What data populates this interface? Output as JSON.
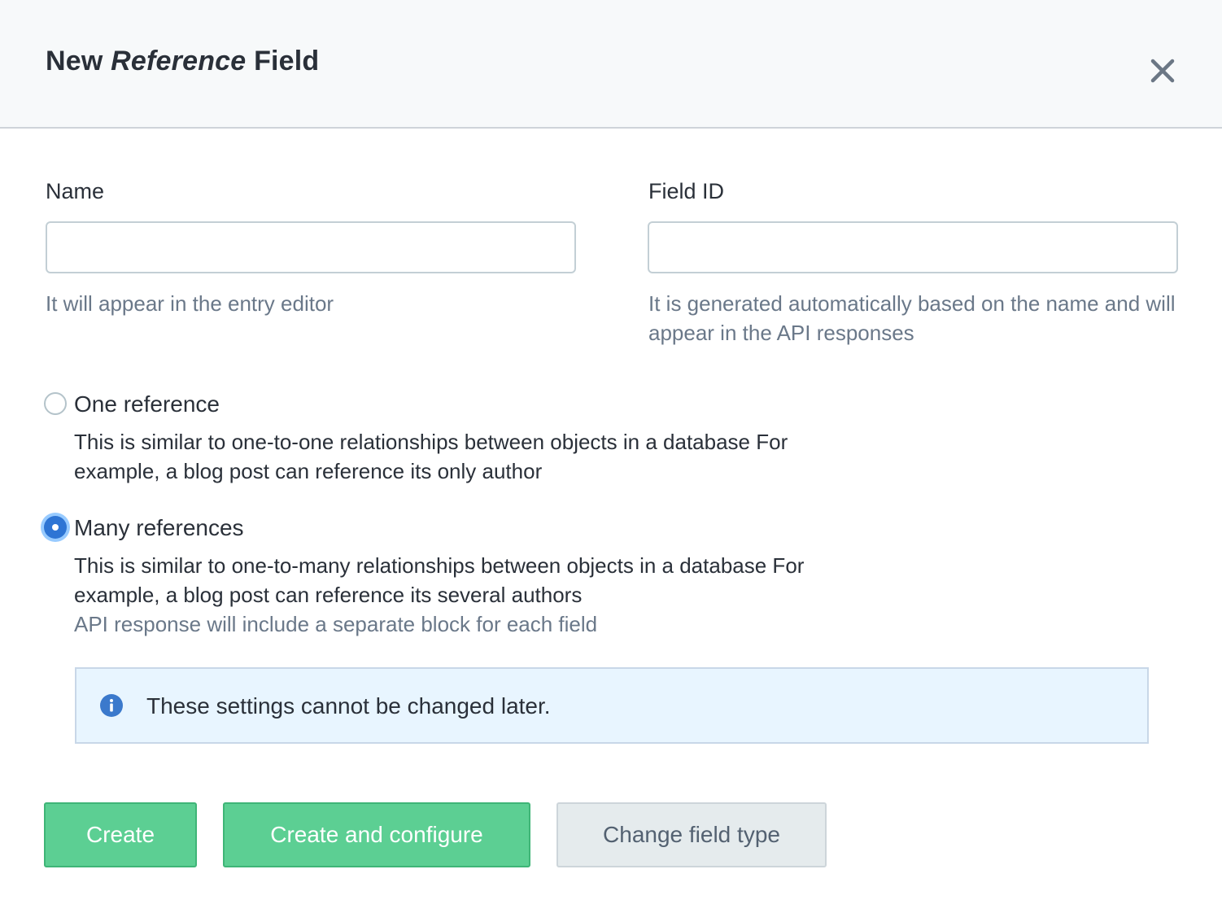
{
  "dialog": {
    "title_prefix": "New",
    "title_type": "Reference",
    "title_suffix": "Field",
    "close_label": "Close"
  },
  "fields": {
    "name": {
      "label": "Name",
      "value": "",
      "placeholder": "",
      "hint": "It will appear in the entry editor"
    },
    "field_id": {
      "label": "Field ID",
      "value": "",
      "placeholder": "",
      "hint": "It is generated automatically based on the name and will appear in the API responses"
    }
  },
  "options": [
    {
      "label": "One reference",
      "description": "This is similar to one-to-one relationships between objects in a database For example, a blog post can reference its only author",
      "note": "",
      "checked": false
    },
    {
      "label": "Many references",
      "description": "This is similar to one-to-many relationships between objects in a database For example, a blog post can reference its several authors",
      "note": "API response will include a separate block for each field",
      "checked": true
    }
  ],
  "notice": {
    "icon": "info-icon",
    "text": "These settings cannot be changed later."
  },
  "buttons": {
    "create": "Create",
    "create_configure": "Create and configure",
    "change_type": "Change field type"
  },
  "colors": {
    "primary": "#5ccf93",
    "accent": "#2e75d4",
    "notice_bg": "#e8f5ff"
  }
}
